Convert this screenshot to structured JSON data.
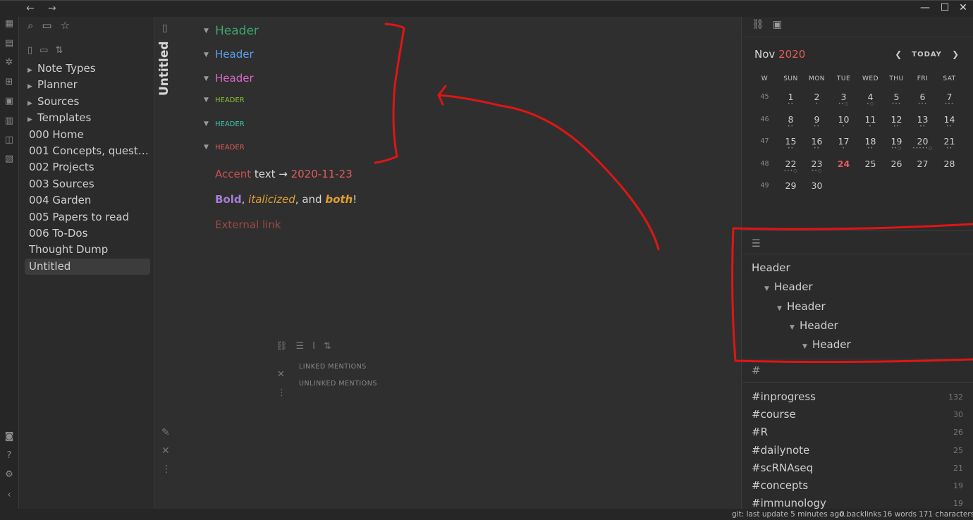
{
  "titlebar": {
    "back": "←",
    "forward": "→",
    "minimize": "—",
    "maximize": "☐",
    "close": "✕"
  },
  "explorer": {
    "items": [
      {
        "label": "Note Types",
        "folder": true
      },
      {
        "label": "Planner",
        "folder": true
      },
      {
        "label": "Sources",
        "folder": true
      },
      {
        "label": "Templates",
        "folder": true
      },
      {
        "label": "000 Home",
        "folder": false
      },
      {
        "label": "001 Concepts, questi...",
        "folder": false
      },
      {
        "label": "002 Projects",
        "folder": false
      },
      {
        "label": "003 Sources",
        "folder": false
      },
      {
        "label": "004 Garden",
        "folder": false
      },
      {
        "label": "005 Papers to read",
        "folder": false
      },
      {
        "label": "006 To-Dos",
        "folder": false
      },
      {
        "label": "Thought Dump",
        "folder": false
      },
      {
        "label": "Untitled",
        "folder": false,
        "active": true
      }
    ]
  },
  "editor": {
    "title": "Untitled",
    "headers": [
      "Header",
      "Header",
      "Header",
      "HEADER",
      "HEADER",
      "HEADER"
    ],
    "line1": {
      "accent": "Accent",
      "text": " text → ",
      "date": "2020-11-23"
    },
    "line2": {
      "bold": "Bold",
      "sep1": ", ",
      "ital": "italicized",
      "sep2": ", and ",
      "both": "both",
      "end": "!"
    },
    "external_link": "External link",
    "linked_mentions": "LINKED MENTIONS",
    "unlinked_mentions": "UNLINKED MENTIONS"
  },
  "calendar": {
    "month": "Nov",
    "year": "2020",
    "today_label": "TODAY",
    "dow": [
      "W",
      "SUN",
      "MON",
      "TUE",
      "WED",
      "THU",
      "FRI",
      "SAT"
    ],
    "weeks": [
      {
        "wk": "45",
        "days": [
          "1",
          "2",
          "3",
          "4",
          "5",
          "6",
          "7"
        ],
        "dots": [
          "••",
          "•",
          "••○",
          "•○",
          "•••",
          "•••",
          "•••"
        ]
      },
      {
        "wk": "46",
        "days": [
          "8",
          "9",
          "10",
          "11",
          "12",
          "13",
          "14"
        ],
        "dots": [
          "••",
          "••",
          "•",
          "•",
          "••",
          "••",
          "••"
        ]
      },
      {
        "wk": "47",
        "days": [
          "15",
          "16",
          "17",
          "18",
          "19",
          "20",
          "21"
        ],
        "dots": [
          "••",
          "••",
          "•",
          "••",
          "••○",
          "•••••○",
          "••"
        ]
      },
      {
        "wk": "48",
        "days": [
          "22",
          "23",
          "24",
          "25",
          "26",
          "27",
          "28"
        ],
        "dots": [
          "•••○",
          "••○",
          "",
          "",
          "",
          "",
          ""
        ]
      },
      {
        "wk": "49",
        "days": [
          "29",
          "30",
          "",
          "",
          "",
          "",
          ""
        ],
        "dots": [
          "",
          "",
          "",
          "",
          "",
          "",
          ""
        ]
      }
    ],
    "today": "24"
  },
  "outline": {
    "items": [
      {
        "label": "Header",
        "level": 0,
        "fold": false
      },
      {
        "label": "Header",
        "level": 1,
        "fold": true
      },
      {
        "label": "Header",
        "level": 2,
        "fold": true
      },
      {
        "label": "Header",
        "level": 3,
        "fold": true
      },
      {
        "label": "Header",
        "level": 4,
        "fold": true
      }
    ]
  },
  "tags": {
    "icon": "#",
    "items": [
      {
        "name": "#inprogress",
        "count": "132"
      },
      {
        "name": "#course",
        "count": "30"
      },
      {
        "name": "#R",
        "count": "26"
      },
      {
        "name": "#dailynote",
        "count": "25"
      },
      {
        "name": "#scRNAseq",
        "count": "21"
      },
      {
        "name": "#concepts",
        "count": "19"
      },
      {
        "name": "#immunology",
        "count": "19"
      }
    ]
  },
  "status": {
    "git": "git: last update 5 minutes ago..",
    "backlinks": "0 backlinks",
    "words": "16 words",
    "chars": "171 characters"
  },
  "colors": {
    "accent": "#e35b5b",
    "annotation": "#e01515"
  }
}
